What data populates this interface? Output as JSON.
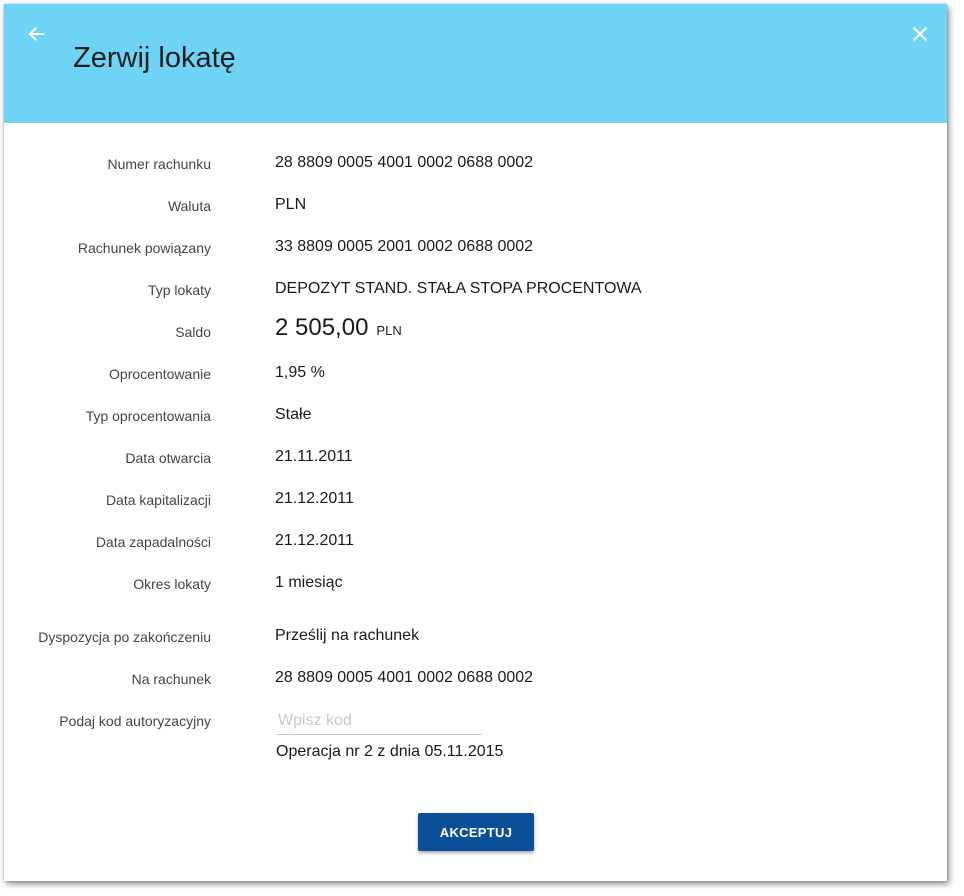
{
  "header": {
    "title": "Zerwij lokatę",
    "background_color": "#6fd3f6",
    "back_icon": "arrow-left-icon",
    "close_icon": "close-icon"
  },
  "details": [
    {
      "label": "Numer rachunku",
      "value": "28 8809 0005 4001 0002 0688 0002"
    },
    {
      "label": "Waluta",
      "value": "PLN"
    },
    {
      "label": "Rachunek powiązany",
      "value": "33 8809 0005 2001 0002 0688 0002"
    },
    {
      "label": "Typ lokaty",
      "value": "DEPOZYT STAND. STAŁA STOPA PROCENTOWA"
    },
    {
      "label": "Saldo",
      "amount": "2 505,00",
      "currency": "PLN"
    },
    {
      "label": "Oprocentowanie",
      "value": "1,95 %"
    },
    {
      "label": "Typ oprocentowania",
      "value": "Stałe"
    },
    {
      "label": "Data otwarcia",
      "value": "21.11.2011"
    },
    {
      "label": "Data kapitalizacji",
      "value": "21.12.2011"
    },
    {
      "label": "Data zapadalności",
      "value": "21.12.2011"
    },
    {
      "label": "Okres lokaty",
      "value": "1 miesiąc"
    },
    {
      "label": "Dyspozycja po zakończeniu",
      "value": "Prześlij na rachunek"
    },
    {
      "label": "Na rachunek",
      "value": "28 8809 0005 4001 0002 0688 0002"
    }
  ],
  "auth": {
    "label": "Podaj kod autoryzacyjny",
    "value": "",
    "placeholder": "Wpisz kod",
    "operation_text": "Operacja nr 2 z dnia 05.11.2015"
  },
  "actions": {
    "accept_label": "AKCEPTUJ",
    "accept_color": "#0a4f98"
  }
}
